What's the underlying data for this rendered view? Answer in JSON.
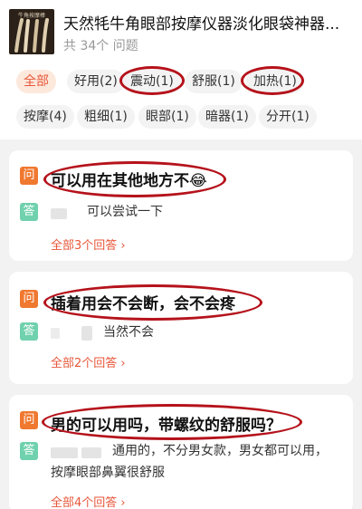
{
  "product": {
    "title": "天然牦牛角眼部按摩仪器淡化眼袋神器...",
    "subtitle": "共 34个 问题",
    "thumb_caption": "牛角按摩棒"
  },
  "tags": [
    {
      "label": "全部",
      "active": true
    },
    {
      "label": "好用(2)"
    },
    {
      "label": "震动(1)"
    },
    {
      "label": "舒服(1)"
    },
    {
      "label": "加热(1)"
    },
    {
      "label": "按摩(4)"
    },
    {
      "label": "粗细(1)"
    },
    {
      "label": "眼部(1)"
    },
    {
      "label": "暗器(1)"
    },
    {
      "label": "分开(1)"
    }
  ],
  "badges": {
    "question": "问",
    "answer": "答"
  },
  "qa": [
    {
      "question": "可以用在其他地方不😂",
      "answer": "可以尝试一下",
      "more": "全部3个回答 ›"
    },
    {
      "question": "插着用会不会断，会不会疼",
      "answer": "当然不会",
      "more": "全部2个回答 ›"
    },
    {
      "question": "男的可以用吗，带螺纹的舒服吗？",
      "answer": "通用的，不分男女款，男女都可以用，",
      "answer_line2": "按摩眼部鼻翼很舒服",
      "more": "全部4个回答 ›"
    }
  ],
  "colors": {
    "accent": "#e8573a",
    "question_badge": "#f0782f",
    "answer_badge": "#6fd1ad",
    "annotation_ring": "#b5121b"
  }
}
